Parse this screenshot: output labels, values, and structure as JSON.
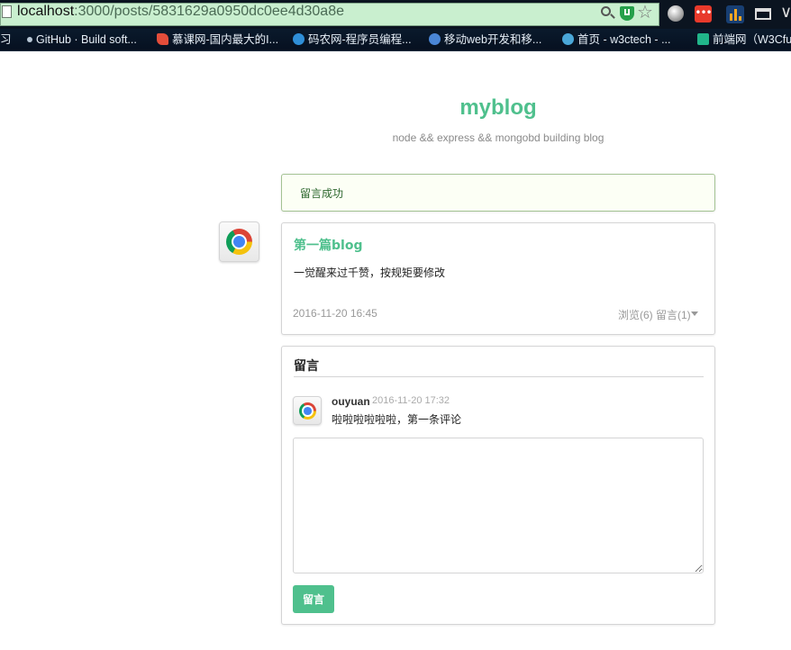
{
  "browser": {
    "url_host": "localhost",
    "url_path": ":3000/posts/5831629a0950dc0ee4d30a8e",
    "bookmarks": [
      {
        "label": "习",
        "icon": "partial-icon",
        "color": "#9fb3c8"
      },
      {
        "label": "GitHub · Build soft...",
        "icon": "github-icon",
        "color": "#b8c7d6"
      },
      {
        "label": "慕课网-国内最大的I...",
        "icon": "imooc-icon",
        "color": "#e44d3a"
      },
      {
        "label": "码农网-程序员编程...",
        "icon": "codeceo-icon",
        "color": "#2f8fd8"
      },
      {
        "label": "移动web开发和移...",
        "icon": "rocket-icon",
        "color": "#4a86d6"
      },
      {
        "label": "首页 - w3ctech - ...",
        "icon": "w3ctech-icon",
        "color": "#4aa7d8"
      },
      {
        "label": "前端网（W3Cfu",
        "icon": "w3cfuns-icon",
        "color": "#21b58a"
      }
    ]
  },
  "site": {
    "title": "myblog",
    "subtitle": "node && express && mongobd building blog"
  },
  "flash": {
    "message": "留言成功"
  },
  "post": {
    "title": "第一篇blog",
    "content": "一觉醒来过千赞，按规矩要修改",
    "date": "2016-11-20 16:45",
    "stats": "浏览(6) 留言(1)"
  },
  "comments": {
    "header": "留言",
    "items": [
      {
        "author": "ouyuan",
        "time": "2016-11-20 17:32",
        "text": "啦啦啦啦啦啦，第一条评论"
      }
    ],
    "input_value": "",
    "submit_label": "留言"
  }
}
